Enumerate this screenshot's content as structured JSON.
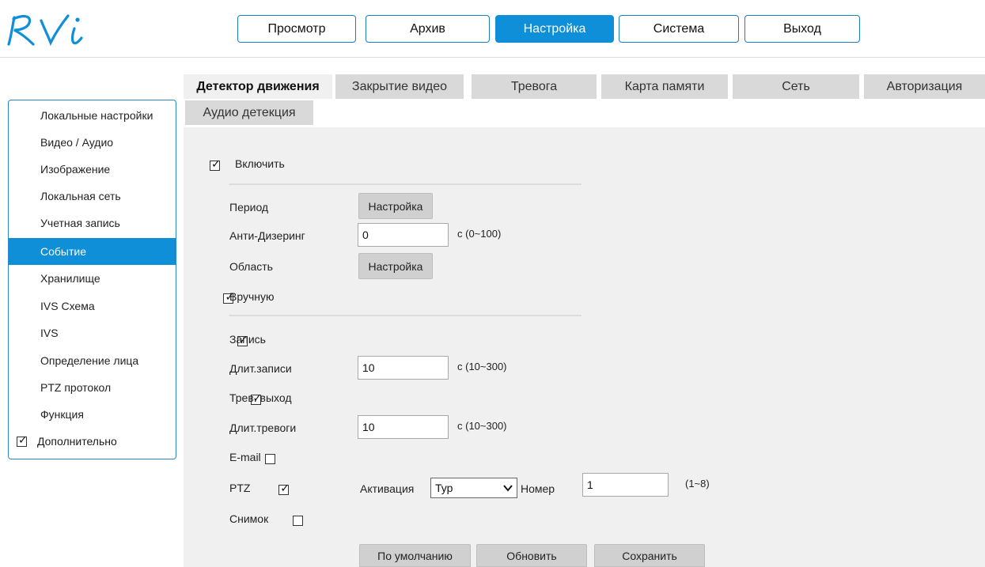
{
  "logo": {
    "text": "RVi",
    "color": "#0f8fd8"
  },
  "nav": {
    "items": [
      {
        "label": "Просмотр",
        "active": false
      },
      {
        "label": "Архив",
        "active": false
      },
      {
        "label": "Настройка",
        "active": true
      },
      {
        "label": "Система",
        "active": false
      },
      {
        "label": "Выход",
        "active": false
      }
    ]
  },
  "sidebar": {
    "items": [
      {
        "label": "Локальные настройки"
      },
      {
        "label": "Видео / Аудио"
      },
      {
        "label": "Изображение"
      },
      {
        "label": "Локальная сеть"
      },
      {
        "label": "Учетная запись"
      },
      {
        "label": "Событие",
        "active": true
      },
      {
        "label": "Хранилище"
      },
      {
        "label": "IVS Схема"
      },
      {
        "label": "IVS"
      },
      {
        "label": "Определение лица"
      },
      {
        "label": "PTZ протокол"
      },
      {
        "label": "Функция"
      }
    ],
    "advanced": {
      "label": "Дополнительно",
      "checked": true
    }
  },
  "tabs": [
    {
      "label": "Детектор движения",
      "active": true
    },
    {
      "label": "Закрытие видео"
    },
    {
      "label": "Тревога"
    },
    {
      "label": "Карта памяти"
    },
    {
      "label": "Сеть"
    },
    {
      "label": "Авторизация"
    },
    {
      "label": "Аудио детекция"
    }
  ],
  "form": {
    "enable": {
      "label": "Включить",
      "checked": true
    },
    "period": {
      "label": "Период",
      "button": "Настройка"
    },
    "anti_dither": {
      "label": "Анти-Дизеринг",
      "value": "0",
      "range": "с (0~100)"
    },
    "area": {
      "label": "Область",
      "button": "Настройка"
    },
    "manual": {
      "label": "Вручную",
      "checked": true
    },
    "record": {
      "label": "Запись",
      "checked": true
    },
    "record_duration": {
      "label": "Длит.записи",
      "value": "10",
      "range": "с (10~300)"
    },
    "alarm_out": {
      "label": "Трев. выход",
      "checked": true
    },
    "alarm_duration": {
      "label": "Длит.тревоги",
      "value": "10",
      "range": "с (10~300)"
    },
    "email": {
      "label": "E-mail",
      "checked": false
    },
    "ptz": {
      "label": "PTZ",
      "checked": true,
      "activation_label": "Активация",
      "activation_value": "Тур",
      "number_label": "Номер",
      "number_value": "1",
      "number_range": "(1~8)"
    },
    "snapshot": {
      "label": "Снимок",
      "checked": false
    }
  },
  "actions": {
    "default": "По умолчанию",
    "refresh": "Обновить",
    "save": "Сохранить"
  }
}
